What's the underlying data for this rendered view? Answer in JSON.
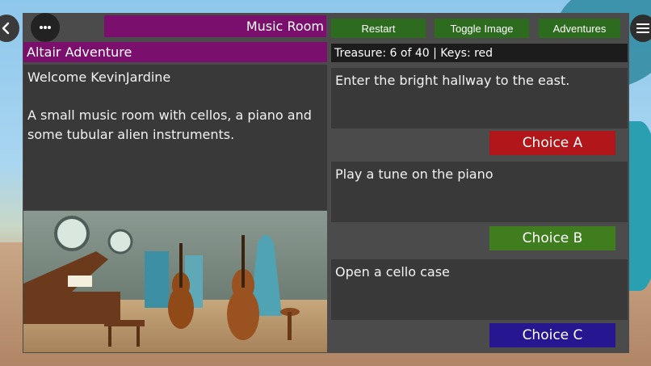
{
  "header": {
    "room_title": "Music Room",
    "adventure_title": "Altair Adventure",
    "buttons": {
      "restart": "Restart",
      "toggle_image": "Toggle Image",
      "adventures": "Adventures"
    },
    "status": "Treasure: 6 of 40 | Keys: red"
  },
  "nav": {
    "back_icon": "chevron-left-icon",
    "more_icon": "more-horizontal-icon",
    "menu_icon": "hamburger-menu-icon"
  },
  "description": {
    "welcome": "Welcome KevinJardine",
    "text": "A small music room with cellos, a piano and some tubular alien instruments."
  },
  "choices": [
    {
      "text": "Enter the bright hallway to the east.",
      "label": "Choice A",
      "color": "#b1161a"
    },
    {
      "text": "Play a tune on the piano",
      "label": "Choice B",
      "color": "#3f7d1e"
    },
    {
      "text": "Open a cello case",
      "label": "Choice C",
      "color": "#26168f"
    }
  ],
  "colors": {
    "title_bar": "#7a0f6e",
    "button_green": "#2d6b1e",
    "panel_bg": "#4b4b4b",
    "text_box_bg": "#393939"
  }
}
